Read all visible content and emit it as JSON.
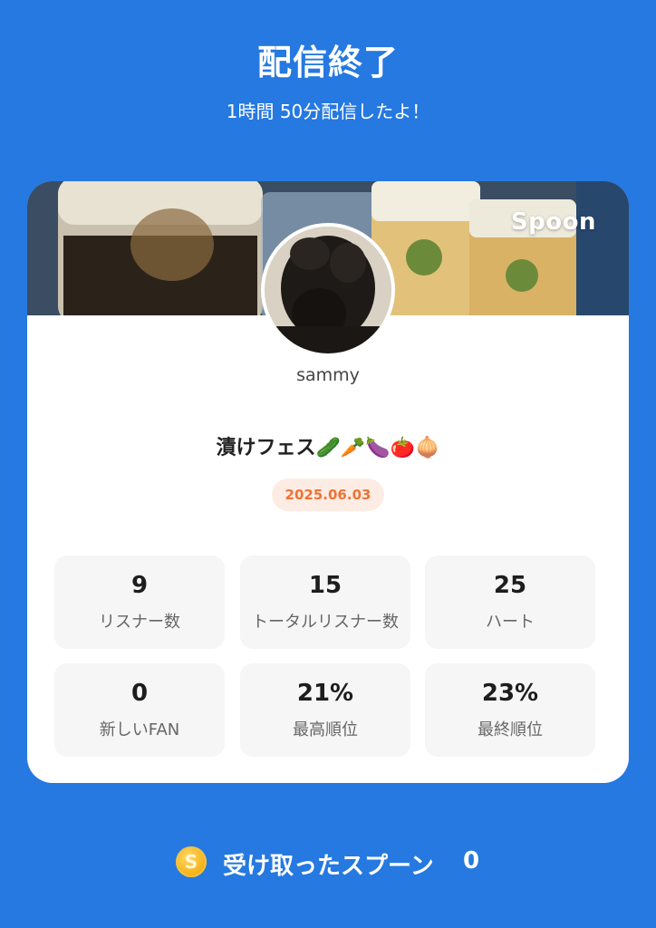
{
  "header": {
    "title": "配信終了",
    "duration_text": "1時間 50分配信したよ！"
  },
  "card": {
    "brand": "Spoon",
    "username": "sammy",
    "live_title": "漬けフェス🥒🥕🍆🍅🧅",
    "date": "2025.06.03",
    "stats": [
      {
        "value": "9",
        "label": "リスナー数"
      },
      {
        "value": "15",
        "label": "トータルリスナー数"
      },
      {
        "value": "25",
        "label": "ハート"
      },
      {
        "value": "0",
        "label": "新しいFAN"
      },
      {
        "value": "21%",
        "label": "最高順位"
      },
      {
        "value": "23%",
        "label": "最終順位"
      }
    ]
  },
  "footer": {
    "coin_glyph": "S",
    "received_label": "受け取ったスプーン",
    "received_count": "0"
  },
  "colors": {
    "background": "#2579e0",
    "card": "#ffffff",
    "date_pill_bg": "#fdece4",
    "date_pill_text": "#f07235",
    "stat_tile": "#f6f6f6",
    "coin": "#f7b51b"
  }
}
